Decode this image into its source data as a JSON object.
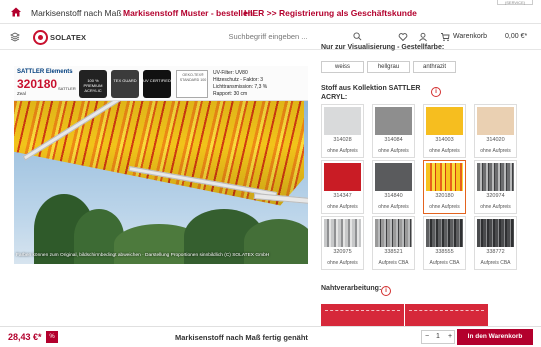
{
  "topnav": {
    "link1": "Markisenstoff nach Maß",
    "link2": "Markisenstoff Muster - bestellen",
    "link3": "HIER >> Registrierung als Geschäftskunde",
    "corner": "(SERVICE)"
  },
  "header": {
    "logo": "SOLATEX",
    "search_placeholder": "Suchbegriff eingeben ...",
    "cart_label": "Warenkorb",
    "cart_total": "0,00 €*"
  },
  "image": {
    "series_title": "SATTLER Elements",
    "product_number": "320180",
    "swatch_label": "Zeal",
    "sattler_logo": "SATTLER",
    "badges": [
      {
        "name": "acrylic-badge",
        "text": "100 % PREMIUM ACRYLIC"
      },
      {
        "name": "tex-guard-badge",
        "text": "TEX GUARD"
      },
      {
        "name": "uv-certified-badge",
        "text": "UV CERTIFIED"
      }
    ],
    "oeko_text": "OEKO-TEX® STANDARD 100",
    "uv_filter": "UV-Filter: UV80",
    "heat_protection": "Hitzeschutz - Faktor: 3",
    "light_transmission": "Lichttransmission: 7,3 %",
    "rapport": "Rapport: 30 cm",
    "caption": "Farben können zum Original, bildschirmbedingt abweichen · Darstellung Proportionen sinnbildlich (C) SOLATEX GmbH"
  },
  "right_panel": {
    "visual_heading": "Nur zur Visualisierung - Gestellfarbe:",
    "visual_buttons": [
      "weiss",
      "hellgrau",
      "anthrazit"
    ],
    "fabrics_heading_line1": "Stoff aus Kollektion SATTLER",
    "fabrics_heading_line2": "ACRYL:",
    "fabrics": [
      {
        "number": "314028",
        "price_note": "ohne Aufpreis",
        "color": "#d9dadb",
        "pattern": "plain"
      },
      {
        "number": "314084",
        "price_note": "ohne Aufpreis",
        "color": "#8e8e8e",
        "pattern": "plain"
      },
      {
        "number": "314003",
        "price_note": "ohne Aufpreis",
        "color": "#f6be1f",
        "pattern": "plain"
      },
      {
        "number": "314020",
        "price_note": "ohne Aufpreis",
        "color": "#ead0b2",
        "pattern": "plain"
      },
      {
        "number": "314347",
        "price_note": "ohne Aufpreis",
        "color": "#c91c25",
        "pattern": "plain"
      },
      {
        "number": "314840",
        "price_note": "ohne Aufpreis",
        "color": "#5a5b5d",
        "pattern": "plain"
      },
      {
        "number": "320180",
        "price_note": "ohne Aufpreis",
        "color": "#f3a31c",
        "pattern": "stripes-orange"
      },
      {
        "number": "320974",
        "price_note": "ohne Aufpreis",
        "color": "#6d6e70",
        "pattern": "stripes-grey"
      },
      {
        "number": "320975",
        "price_note": "ohne Aufpreis",
        "color": "#8f9092",
        "pattern": "stripes-light"
      },
      {
        "number": "338521",
        "price_note": "Aufpreis CBA",
        "color": "#9a9a9a",
        "pattern": "stripes-grey"
      },
      {
        "number": "338555",
        "price_note": "Aufpreis CBA",
        "color": "#5d5e60",
        "pattern": "stripes-dark"
      },
      {
        "number": "338772",
        "price_note": "Aufpreis CBA",
        "color": "#4a4b4d",
        "pattern": "stripes-dark"
      }
    ],
    "seam_heading": "Nahtverarbeitung:"
  },
  "bottom": {
    "price": "28,43 €*",
    "discount_badge": "%",
    "product_title": "Markisenstoff nach Maß fertig genäht",
    "qty_minus": "−",
    "qty_value": "1",
    "qty_plus": "+",
    "add_to_cart": "In den Warenkorb"
  }
}
